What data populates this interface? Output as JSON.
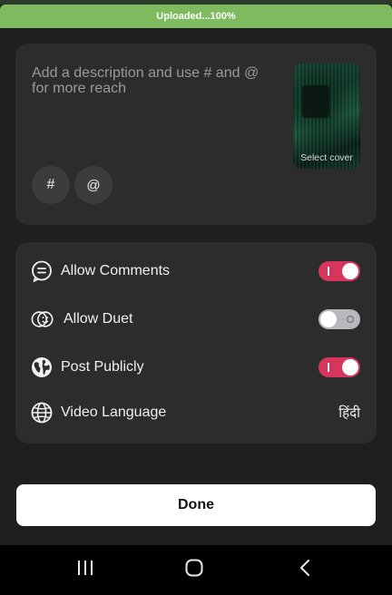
{
  "upload": {
    "status_text": "Uploaded...100%",
    "progress": 1.0,
    "color": "#7dbb5e"
  },
  "description": {
    "placeholder": "Add a description and use # and @ for more reach",
    "cover_label": "Select cover",
    "hashtag_chip": "#",
    "mention_chip": "@"
  },
  "settings": {
    "allow_comments": {
      "label": "Allow Comments",
      "icon": "chat-bubble-icon",
      "enabled": true
    },
    "allow_duet": {
      "label": "Allow Duet",
      "icon": "duet-icon",
      "enabled": false
    },
    "post_publicly": {
      "label": "Post Publicly",
      "icon": "globe-icon",
      "enabled": true
    },
    "video_language": {
      "label": "Video Language",
      "icon": "language-globe-icon",
      "value": "हिंदी"
    }
  },
  "done_button": {
    "label": "Done"
  },
  "nav": {
    "recents": "recents-icon",
    "home": "home-icon",
    "back": "back-icon"
  },
  "colors": {
    "toggle_on": "#d7345e",
    "toggle_off": "#b8b8bc",
    "background": "#1f1f1f",
    "card": "#2c2c2c"
  }
}
